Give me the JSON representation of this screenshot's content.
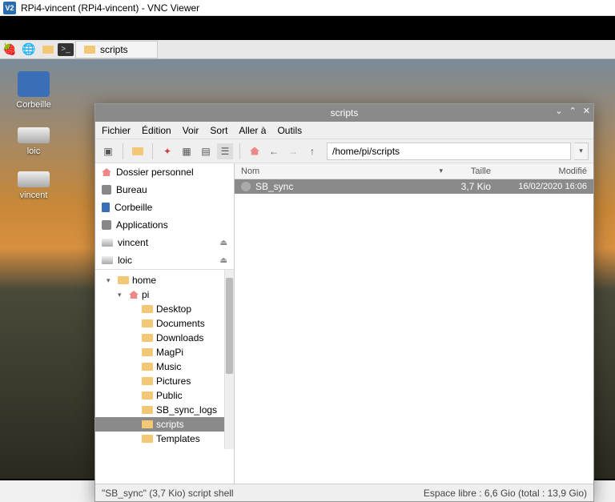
{
  "vnc": {
    "title": "RPi4-vincent (RPi4-vincent) - VNC Viewer",
    "logo": "V2"
  },
  "taskbar": {
    "task_label": "scripts"
  },
  "desktop_icons": {
    "trash": "Corbeille",
    "drive1": "loic",
    "drive2": "vincent"
  },
  "fm": {
    "title": "scripts",
    "btns": {
      "min": "⌄",
      "max": "⌃",
      "close": "✕"
    },
    "menu": {
      "file": "Fichier",
      "edit": "Édition",
      "view": "Voir",
      "sort": "Sort",
      "go": "Aller à",
      "tools": "Outils"
    },
    "path": "/home/pi/scripts",
    "places": {
      "home": "Dossier personnel",
      "desktop": "Bureau",
      "trash": "Corbeille",
      "apps": "Applications",
      "drive_vincent": "vincent",
      "drive_loic": "loic"
    },
    "tree": {
      "home": "home",
      "pi": "pi",
      "items": [
        "Desktop",
        "Documents",
        "Downloads",
        "MagPi",
        "Music",
        "Pictures",
        "Public",
        "SB_sync_logs",
        "scripts",
        "Templates"
      ]
    },
    "cols": {
      "name": "Nom",
      "size": "Taille",
      "modified": "Modifié"
    },
    "files": [
      {
        "name": "SB_sync",
        "size": "3,7 Kio",
        "modified": "16/02/2020 16:06"
      }
    ],
    "status_left": "\"SB_sync\" (3,7 Kio) script shell",
    "status_right": "Espace libre : 6,6 Gio (total : 13,9 Gio)"
  }
}
